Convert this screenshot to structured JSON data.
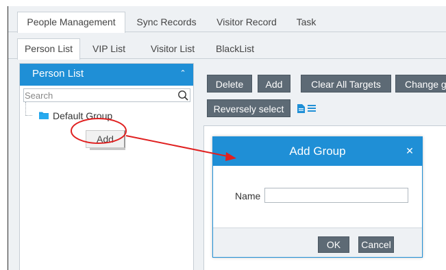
{
  "main_tabs": [
    {
      "label": "People Management",
      "active": true
    },
    {
      "label": "Sync Records",
      "active": false
    },
    {
      "label": "Visitor Record",
      "active": false
    },
    {
      "label": "Task",
      "active": false
    }
  ],
  "sub_tabs": [
    {
      "label": "Person List",
      "active": true
    },
    {
      "label": "VIP List",
      "active": false
    },
    {
      "label": "Visitor List",
      "active": false
    },
    {
      "label": "BlackList",
      "active": false
    }
  ],
  "left_panel": {
    "title": "Person List",
    "search_placeholder": "Search",
    "tree": [
      {
        "label": "Default Group",
        "icon": "folder-icon"
      }
    ],
    "context_menu": {
      "add_label": "Add"
    }
  },
  "toolbar": {
    "delete_label": "Delete",
    "add_label": "Add",
    "clear_targets_label": "Clear All Targets",
    "change_label": "Change g",
    "reverse_select_label": "Reversely select"
  },
  "dialog": {
    "title": "Add Group",
    "name_label": "Name",
    "name_value": "",
    "ok_label": "OK",
    "cancel_label": "Cancel"
  },
  "colors": {
    "accent": "#1f8fd6",
    "button": "#5d6a75",
    "annotation": "#e02020"
  }
}
